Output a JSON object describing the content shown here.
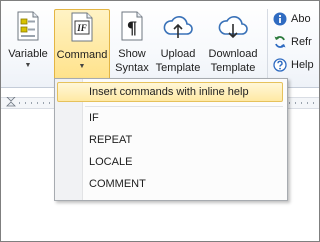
{
  "ribbon": {
    "buttons": [
      {
        "id": "variable",
        "label": "Variable",
        "has_dropdown": true
      },
      {
        "id": "command",
        "label": "Command",
        "has_dropdown": true,
        "active": true
      },
      {
        "id": "show_syntax",
        "label_line1": "Show",
        "label_line2": "Syntax"
      },
      {
        "id": "upload_template",
        "label_line1": "Upload",
        "label_line2": "Template"
      },
      {
        "id": "download_template",
        "label_line1": "Download",
        "label_line2": "Template"
      }
    ],
    "small_buttons": [
      {
        "id": "about",
        "label": "Abo",
        "icon": "info-icon"
      },
      {
        "id": "refresh",
        "label": "Refr",
        "icon": "refresh-icon"
      },
      {
        "id": "help",
        "label": "Help",
        "icon": "help-icon"
      }
    ],
    "icon_texts": {
      "command": "IF",
      "show_syntax": "¶"
    }
  },
  "command_menu": {
    "items": [
      {
        "label": "Insert commands with inline help",
        "highlighted": true
      },
      {
        "label": "IF"
      },
      {
        "label": "REPEAT"
      },
      {
        "label": "LOCALE"
      },
      {
        "label": "COMMENT"
      }
    ]
  },
  "colors": {
    "accent_highlight": "#ffe28a",
    "highlight_border": "#e3b544",
    "cloud_icon": "#3a72b8",
    "info_icon": "#2f6bc1",
    "refresh_icon": "#2b7a3b"
  }
}
